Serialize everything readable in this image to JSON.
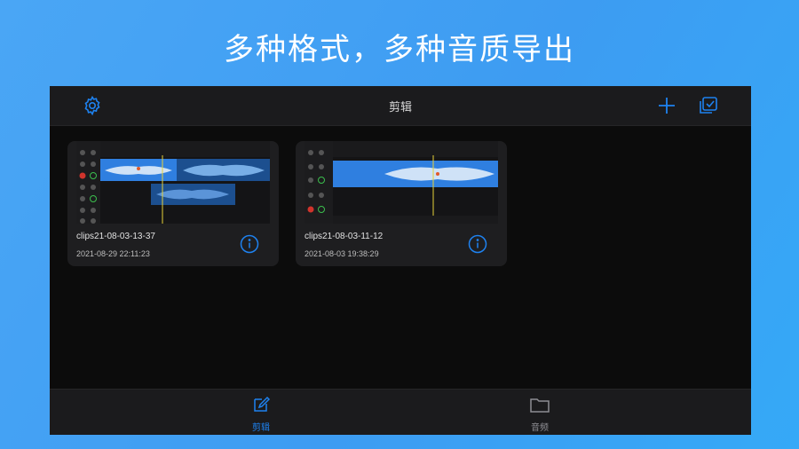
{
  "headline": "多种格式，多种音质导出",
  "nav": {
    "title": "剪辑",
    "settings_icon": "gear-icon",
    "add_icon": "plus-icon",
    "select_icon": "multi-select-icon",
    "accent": "#1e82f0"
  },
  "projects": [
    {
      "name": "clips21-08-03-13-37",
      "date": "2021-08-29 22:11:23"
    },
    {
      "name": "clips21-08-03-11-12",
      "date": "2021-08-03 19:38:29"
    }
  ],
  "tabs": [
    {
      "label": "剪辑",
      "icon": "edit-icon",
      "active": true
    },
    {
      "label": "音频",
      "icon": "folder-icon",
      "active": false
    }
  ]
}
